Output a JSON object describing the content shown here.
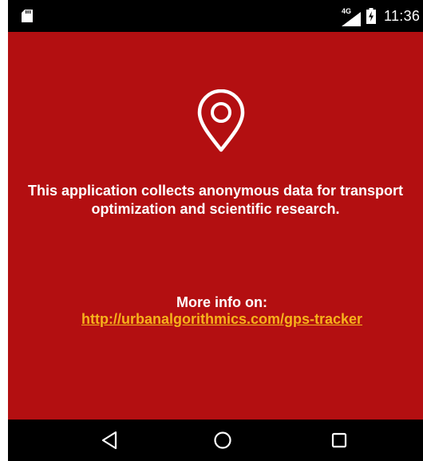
{
  "status_bar": {
    "network_type": "4G",
    "time": "11:36",
    "icons": [
      "sd-card-icon",
      "signal-icon",
      "battery-charging-icon"
    ]
  },
  "main": {
    "icon": "location-pin-icon",
    "message": "This application collects anonymous data for transport\noptimization and scientific research.",
    "more_info_label": "More info on:",
    "more_info_link": "http://urbanalgorithmics.com/gps-tracker"
  },
  "nav_bar": {
    "buttons": [
      "back-button",
      "home-button",
      "recents-button"
    ]
  },
  "colors": {
    "background": "#b30f11",
    "link": "#f6b21b",
    "bars": "#000000"
  }
}
